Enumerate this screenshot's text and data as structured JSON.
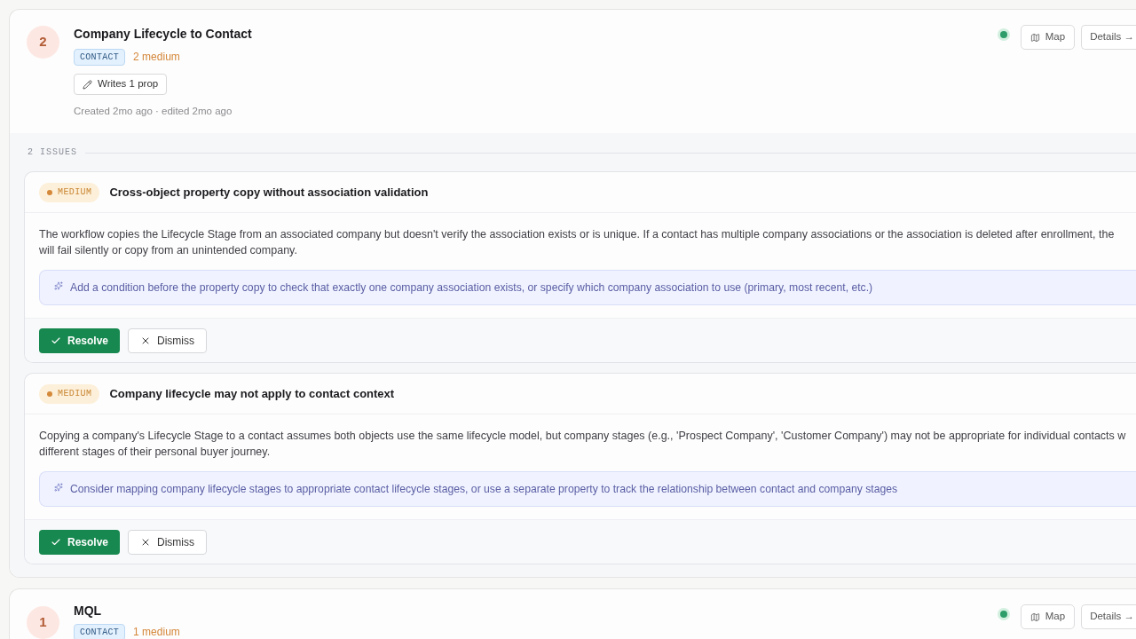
{
  "workflows": [
    {
      "number": "2",
      "title": "Company Lifecycle to Contact",
      "object_tag": "CONTACT",
      "severity_summary": "2 medium",
      "writes_button": "Writes 1 prop",
      "meta": "Created 2mo ago · edited 2mo ago",
      "color": "#2e9d6a",
      "map_button": "Map",
      "details_button": "Details →",
      "issues_label": "2 ISSUES",
      "issues": [
        {
          "severity": "MEDIUM",
          "color": "#d4893a",
          "title": "Cross-object property copy without association validation",
          "description": "The workflow copies the Lifecycle Stage from an associated company but doesn't verify the association exists or is unique. If a contact has multiple company associations or the association is deleted after enrollment, the\nwill fail silently or copy from an unintended company.",
          "suggestion": "Add a condition before the property copy to check that exactly one company association exists, or specify which company association to use (primary, most recent, etc.)",
          "resolve_button": "Resolve",
          "dismiss_button": "Dismiss"
        },
        {
          "severity": "MEDIUM",
          "color": "#d4893a",
          "title": "Company lifecycle may not apply to contact context",
          "description": "Copying a company's Lifecycle Stage to a contact assumes both objects use the same lifecycle model, but company stages (e.g., 'Prospect Company', 'Customer Company') may not be appropriate for individual contacts w\ndifferent stages of their personal buyer journey.",
          "suggestion": "Consider mapping company lifecycle stages to appropriate contact lifecycle stages, or use a separate property to track the relationship between contact and company stages",
          "resolve_button": "Resolve",
          "dismiss_button": "Dismiss"
        }
      ]
    },
    {
      "number": "1",
      "title": "MQL",
      "object_tag": "CONTACT",
      "severity_summary": "1 medium",
      "color": "#2e9d6a",
      "map_button": "Map",
      "details_button": "Details →"
    }
  ]
}
